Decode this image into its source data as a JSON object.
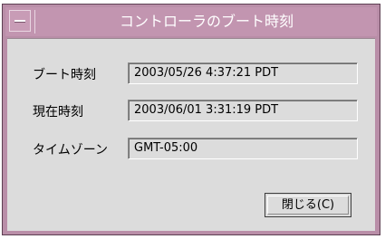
{
  "window": {
    "title": "コントローラのブート時刻"
  },
  "fields": {
    "boot_time": {
      "label": "ブート時刻",
      "value": "2003/05/26 4:37:21 PDT"
    },
    "current_time": {
      "label": "現在時刻",
      "value": "2003/06/01 3:31:19 PDT"
    },
    "timezone": {
      "label": "タイムゾーン",
      "value": "GMT-05:00"
    }
  },
  "buttons": {
    "close_label": "閉じる(C)"
  },
  "icons": {
    "window_menu": "window-menu-icon"
  },
  "colors": {
    "titlebar": "#c295b0",
    "frame": "#b98ea8",
    "client": "#dcdcdc"
  }
}
